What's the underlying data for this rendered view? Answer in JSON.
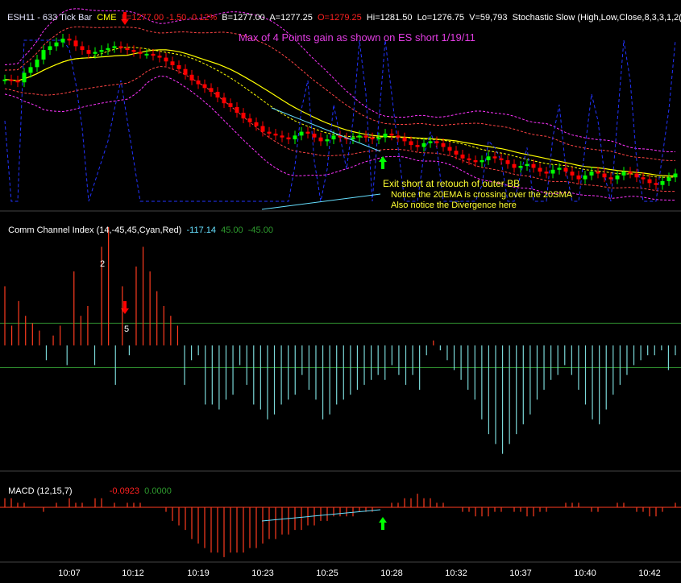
{
  "colors": {
    "background": "#000000",
    "bull": "#00ff00",
    "bear": "#ff0000",
    "ema": "#ffff00",
    "sma": "#ffff00",
    "bb": "#ff4444",
    "kelt": "#ff33ff",
    "stoch": "#2233ff",
    "cci_pos": "#ff3b1f",
    "cci_neg": "#7ad7d7",
    "macd": "#ff3b1f",
    "guide": "#2e8b2e",
    "divergence": "#66e0ff",
    "title_magenta": "#e23de2",
    "note_yellow": "#ffff33"
  },
  "price_panel": {
    "symbol": "ESH11 - 633 Tick Bar",
    "exchange": "CME",
    "last": "L=1277.00",
    "change": "-1.50",
    "pct": "-0.12%",
    "bid": "B=1277.00",
    "ask": "A=1277.25",
    "open": "O=1279.25",
    "hi": "Hi=1281.50",
    "lo": "Lo=1276.75",
    "volume": "V=59,793",
    "stoch_label": "Stochastic Slow (High,Low,Close,8,3,3,1,2(",
    "title": "Max of 4 Points gain as shown on ES short 1/19/11",
    "exit_note": "Exit short at retouch of outer BB",
    "ema_note": "Notice the 20EMA is crossing over the 20SMA",
    "div_note": "Also notice the Divergence here"
  },
  "cci_panel": {
    "label": "Comm Channel Index (14,-45,45,Cyan,Red)",
    "value": "-117.14",
    "upper": "45.00",
    "lower": "-45.00",
    "marker_a": "2",
    "marker_b": "5"
  },
  "macd_panel": {
    "label": "MACD (12,15,7)",
    "value": "-0.0923",
    "zero": "0.0000"
  },
  "x_axis": {
    "labels": [
      "10:07",
      "10:12",
      "10:19",
      "10:23",
      "10:25",
      "10:28",
      "10:32",
      "10:37",
      "10:40",
      "10:42"
    ]
  },
  "chart_data": {
    "type": "candlestick",
    "bar_count": 105,
    "price_close": [
      1279.25,
      1279.2,
      1279.1,
      1279.6,
      1279.9,
      1280.3,
      1280.8,
      1281.0,
      1281.2,
      1281.4,
      1281.3,
      1281.0,
      1280.8,
      1280.6,
      1280.7,
      1280.8,
      1280.9,
      1281.0,
      1280.9,
      1280.8,
      1280.7,
      1280.6,
      1280.6,
      1280.5,
      1280.4,
      1280.2,
      1280.0,
      1279.8,
      1279.5,
      1279.2,
      1279.0,
      1278.8,
      1278.6,
      1278.3,
      1278.0,
      1277.8,
      1277.5,
      1277.2,
      1277.0,
      1276.8,
      1276.5,
      1276.4,
      1276.3,
      1276.2,
      1276.1,
      1276.3,
      1276.5,
      1276.4,
      1276.2,
      1276.0,
      1276.1,
      1276.3,
      1276.2,
      1276.1,
      1276.2,
      1276.3,
      1276.2,
      1276.1,
      1276.2,
      1276.4,
      1276.3,
      1276.2,
      1276.0,
      1275.8,
      1275.7,
      1275.9,
      1276.0,
      1275.9,
      1275.7,
      1275.5,
      1275.3,
      1275.1,
      1275.0,
      1274.9,
      1275.0,
      1275.2,
      1275.1,
      1275.0,
      1274.8,
      1274.6,
      1274.7,
      1274.8,
      1274.6,
      1274.4,
      1274.3,
      1274.5,
      1274.6,
      1274.4,
      1274.2,
      1274.0,
      1274.2,
      1274.4,
      1274.3,
      1274.1,
      1274.0,
      1274.2,
      1274.4,
      1274.3,
      1274.1,
      1274.0,
      1273.8,
      1273.7,
      1273.9,
      1274.1,
      1274.3
    ],
    "cci": [
      120,
      40,
      90,
      60,
      45,
      30,
      -30,
      20,
      40,
      -40,
      150,
      60,
      80,
      -40,
      200,
      240,
      -80,
      120,
      -20,
      160,
      200,
      150,
      110,
      80,
      60,
      40,
      -80,
      -30,
      -20,
      -120,
      -120,
      -130,
      -110,
      -100,
      -40,
      -80,
      -120,
      -130,
      -150,
      -140,
      -120,
      -110,
      -100,
      -60,
      -90,
      -110,
      -150,
      -140,
      -120,
      -110,
      -100,
      -90,
      -80,
      -70,
      -60,
      -70,
      -40,
      -60,
      -80,
      -60,
      -90,
      -20,
      10,
      -10,
      -30,
      -50,
      -70,
      -90,
      -110,
      -150,
      -180,
      -200,
      -220,
      -200,
      -180,
      -160,
      -140,
      -110,
      -90,
      -70,
      -60,
      -40,
      -60,
      -90,
      -120,
      -150,
      -160,
      -130,
      -100,
      -80,
      -60,
      -40,
      -30,
      -20,
      -20,
      -10,
      -50,
      -20
    ],
    "cci_range": [
      -250,
      240
    ],
    "cci_levels": [
      45,
      -45
    ],
    "macd_hist": [
      0.02,
      0.02,
      0.01,
      0.01,
      0.0,
      0.0,
      -0.01,
      0.0,
      0.01,
      0.0,
      0.02,
      0.01,
      0.01,
      0.0,
      0.02,
      0.02,
      0.0,
      0.01,
      0.0,
      0.01,
      0.01,
      0.01,
      0.0,
      0.0,
      0.0,
      -0.01,
      -0.03,
      -0.04,
      -0.05,
      -0.07,
      -0.08,
      -0.09,
      -0.1,
      -0.1,
      -0.11,
      -0.1,
      -0.1,
      -0.1,
      -0.09,
      -0.09,
      -0.08,
      -0.07,
      -0.07,
      -0.06,
      -0.06,
      -0.05,
      -0.05,
      -0.04,
      -0.04,
      -0.03,
      -0.03,
      -0.02,
      -0.02,
      -0.02,
      -0.02,
      -0.01,
      -0.01,
      -0.01,
      -0.0,
      -0.0,
      0.01,
      0.01,
      0.02,
      0.02,
      0.03,
      0.02,
      0.02,
      0.01,
      0.01,
      0.0,
      0.0,
      -0.01,
      -0.01,
      -0.02,
      -0.02,
      -0.02,
      -0.01,
      -0.01,
      -0.0,
      -0.01,
      -0.01,
      -0.02,
      -0.02,
      -0.01,
      -0.01,
      -0.0,
      0.0,
      0.01,
      0.01,
      0.01,
      0.0,
      -0.01,
      -0.01,
      -0.0,
      0.0,
      0.01,
      0.01,
      0.0,
      -0.01,
      -0.01,
      -0.02,
      -0.02,
      -0.01,
      -0.0,
      0.01
    ],
    "macd_range": [
      -0.12,
      0.04
    ]
  }
}
